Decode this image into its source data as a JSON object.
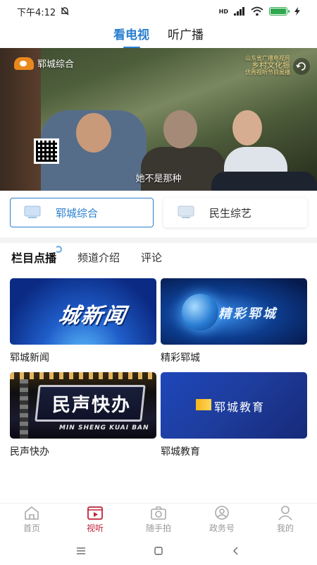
{
  "status_bar": {
    "time": "下午4:12",
    "network": "HD"
  },
  "top_tabs": [
    {
      "label": "看电视",
      "active": true
    },
    {
      "label": "听广播",
      "active": false
    }
  ],
  "video": {
    "station_logo_text": "郓城综合",
    "subtitle": "她不是那种",
    "award_line1": "山东省广播电视局",
    "award_line2": "乡村文化振",
    "award_line3": "优秀视听节目展播"
  },
  "channels": [
    {
      "label": "郓城综合",
      "active": true
    },
    {
      "label": "民生综艺",
      "active": false
    }
  ],
  "section_tabs": [
    {
      "label": "栏目点播",
      "active": true
    },
    {
      "label": "频道介绍",
      "active": false
    },
    {
      "label": "评论",
      "active": false
    }
  ],
  "programs": [
    {
      "title": "郓城新闻",
      "thumb_text": "城新闻"
    },
    {
      "title": "精彩郓城",
      "thumb_text": "精彩郓城"
    },
    {
      "title": "民声快办",
      "thumb_text": "民声快办",
      "thumb_sub": "MIN SHENG KUAI BAN"
    },
    {
      "title": "郓城教育",
      "thumb_text": "郓城教育"
    }
  ],
  "bottom_nav": [
    {
      "label": "首页",
      "icon": "home-icon"
    },
    {
      "label": "视听",
      "icon": "play-icon",
      "active": true
    },
    {
      "label": "随手拍",
      "icon": "camera-icon"
    },
    {
      "label": "政务号",
      "icon": "government-icon"
    },
    {
      "label": "我的",
      "icon": "user-icon"
    }
  ],
  "colors": {
    "accent": "#2a7fcf",
    "nav_active": "#c0243a",
    "inactive": "#999999"
  }
}
